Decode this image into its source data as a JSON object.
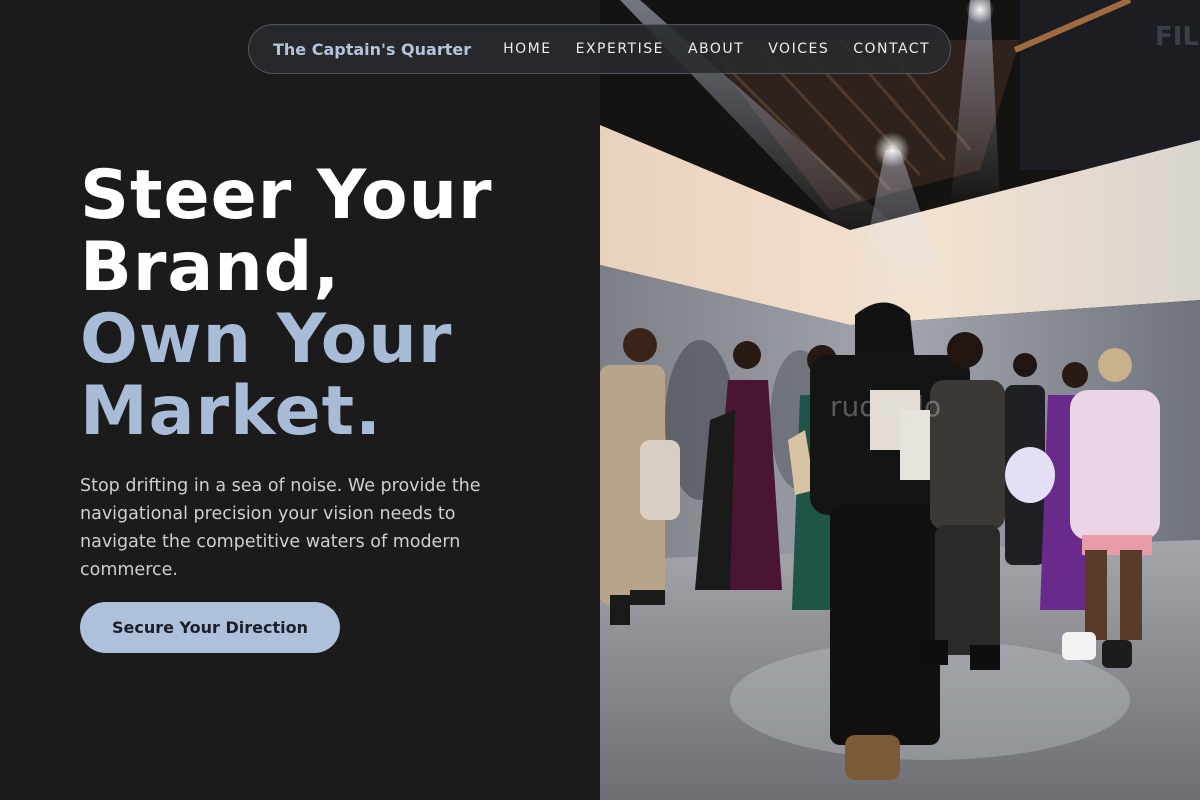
{
  "nav": {
    "brand": "The Captain's Quarter",
    "links": [
      "HOME",
      "EXPERTISE",
      "ABOUT",
      "VOICES",
      "CONTACT"
    ]
  },
  "hero": {
    "title_line_1": "Steer Your",
    "title_line_2": "Brand,",
    "title_line_3": "Own Your",
    "title_line_4": "Market.",
    "description": "Stop drifting in a sea of noise. We provide the navigational precision your vision needs to navigate the competitive waters of modern commerce.",
    "cta_label": "Secure Your Direction"
  },
  "image": {
    "watermark": "rudy.dlo"
  },
  "colors": {
    "background": "#1b1b1c",
    "accent": "#a8bcd8",
    "button": "#aec0da",
    "text": "#ffffff"
  }
}
